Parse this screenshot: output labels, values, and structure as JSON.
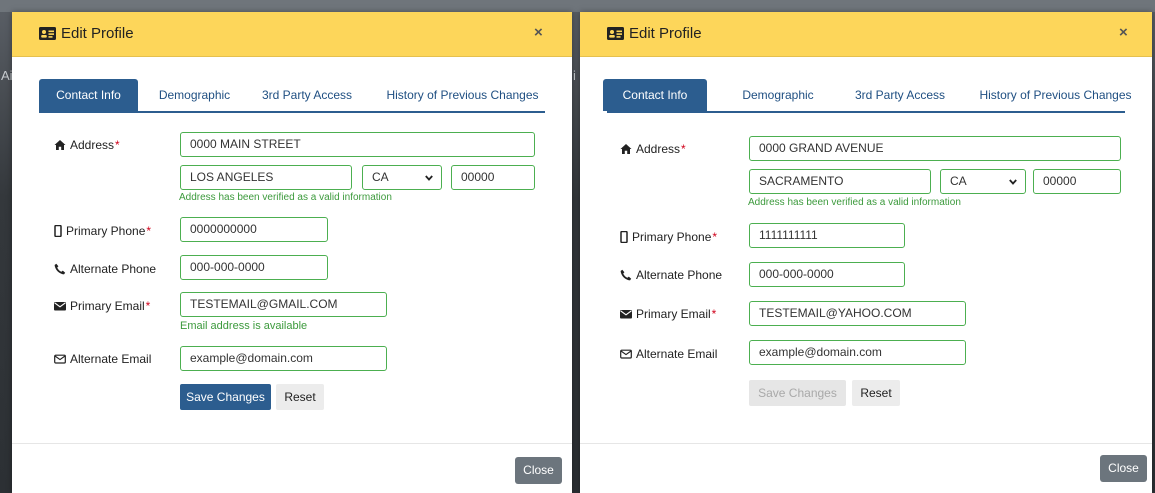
{
  "background": {
    "left_text": "Ai",
    "right_text": "i"
  },
  "colors": {
    "header_yellow": "#fdd65a",
    "tab_blue": "#2c5d8f",
    "valid_green": "#4caf50",
    "hint_green": "#3c9a3c",
    "required_red": "#d0021b",
    "close_gray": "#6c757d"
  },
  "modals": [
    {
      "title": "Edit Profile",
      "title_icon": "id-card-icon",
      "close_symbol": "×",
      "tabs": [
        {
          "label": "Contact Info",
          "active": true
        },
        {
          "label": "Demographic",
          "active": false
        },
        {
          "label": "3rd Party Access",
          "active": false
        },
        {
          "label": "History of Previous Changes",
          "active": false
        }
      ],
      "labels": {
        "address": "Address",
        "primary_phone": "Primary Phone",
        "alternate_phone": "Alternate Phone",
        "primary_email": "Primary Email",
        "alternate_email": "Alternate Email",
        "required_mark": "*"
      },
      "fields": {
        "street": "0000 MAIN STREET",
        "city": "LOS ANGELES",
        "state": "CA",
        "zip": "00000",
        "address_hint": "Address has been verified as a valid information",
        "primary_phone": "0000000000",
        "alternate_phone_placeholder": "000-000-0000",
        "primary_email": "TESTEMAIL@GMAIL.COM",
        "email_hint": "Email address is available",
        "alternate_email_placeholder": "example@domain.com"
      },
      "buttons": {
        "save": "Save Changes",
        "save_enabled": true,
        "reset": "Reset",
        "close": "Close"
      }
    },
    {
      "title": "Edit Profile",
      "title_icon": "id-card-icon",
      "close_symbol": "×",
      "tabs": [
        {
          "label": "Contact Info",
          "active": true
        },
        {
          "label": "Demographic",
          "active": false
        },
        {
          "label": "3rd Party Access",
          "active": false
        },
        {
          "label": "History of Previous Changes",
          "active": false
        }
      ],
      "labels": {
        "address": "Address",
        "primary_phone": "Primary Phone",
        "alternate_phone": "Alternate Phone",
        "primary_email": "Primary Email",
        "alternate_email": "Alternate Email",
        "required_mark": "*"
      },
      "fields": {
        "street": "0000 GRAND AVENUE",
        "city": "SACRAMENTO",
        "state": "CA",
        "zip": "00000",
        "address_hint": "Address has been verified as a valid information",
        "primary_phone": "1111111111",
        "alternate_phone_placeholder": "000-000-0000",
        "primary_email": "TESTEMAIL@YAHOO.COM",
        "alternate_email_placeholder": "example@domain.com"
      },
      "buttons": {
        "save": "Save Changes",
        "save_enabled": false,
        "reset": "Reset",
        "close": "Close"
      }
    }
  ]
}
